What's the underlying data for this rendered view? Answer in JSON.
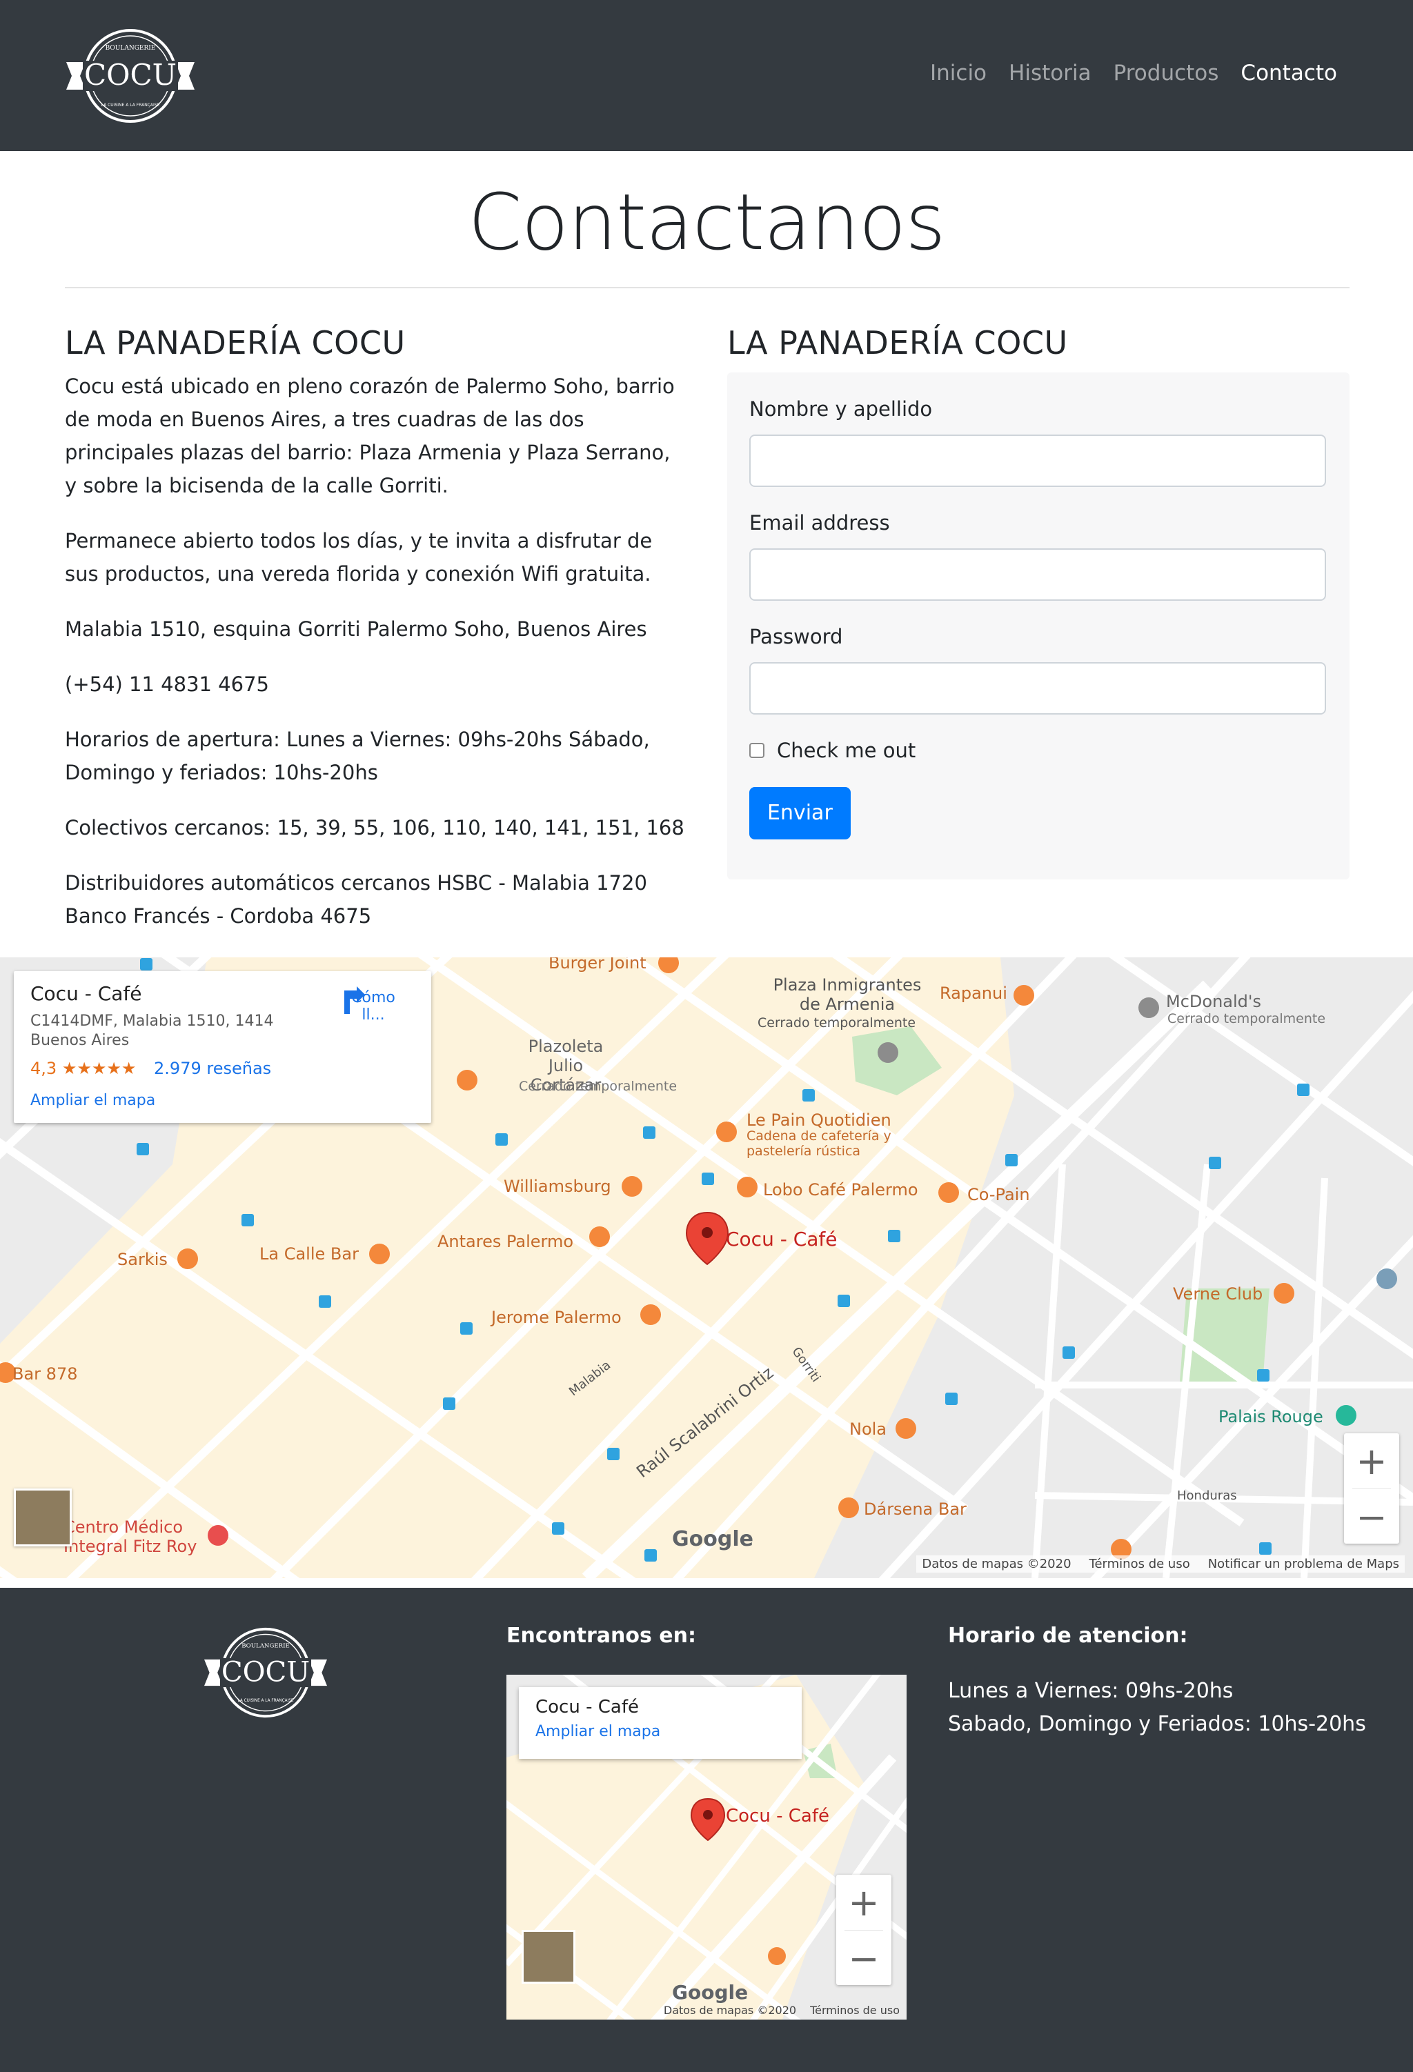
{
  "navbar": {
    "logo": {
      "text": "COCU",
      "arc_text": "BOULANGERIE",
      "tagline": "LA CUISINE A LA FRANÇAISE"
    },
    "links": [
      {
        "label": "Inicio",
        "active": false
      },
      {
        "label": "Historia",
        "active": false
      },
      {
        "label": "Productos",
        "active": false
      },
      {
        "label": "Contacto",
        "active": true
      }
    ]
  },
  "header": {
    "title": "Contactanos"
  },
  "info": {
    "title": "LA PANADERÍA COCU",
    "paragraphs": [
      "Cocu está ubicado en pleno corazón de Palermo Soho, barrio de moda en Buenos Aires, a tres cuadras de las dos principales plazas del barrio: Plaza Armenia y Plaza Serrano, y sobre la bicisenda de la calle Gorriti.",
      "Permanece abierto todos los días, y te invita a disfrutar de sus productos, una vereda florida y conexión Wifi gratuita.",
      "Malabia 1510, esquina Gorriti Palermo Soho, Buenos Aires",
      "(+54) 11 4831 4675",
      "Horarios de apertura: Lunes a Viernes: 09hs-20hs Sábado, Domingo y feriados: 10hs-20hs",
      "Colectivos cercanos: 15, 39, 55, 106, 110, 140, 141, 151, 168",
      "Distribuidores automáticos cercanos HSBC - Malabia 1720 Banco Francés - Cordoba 4675"
    ]
  },
  "form": {
    "title": "LA PANADERÍA COCU",
    "fields": [
      {
        "label": "Nombre y apellido",
        "value": ""
      },
      {
        "label": "Email address",
        "value": ""
      },
      {
        "label": "Password",
        "value": ""
      }
    ],
    "checkbox_label": "Check me out",
    "submit_label": "Enviar",
    "accent_color": "#007bff"
  },
  "map": {
    "card": {
      "title": "Cocu - Café",
      "address": "C1414DMF, Malabia 1510, 1414 Buenos Aires",
      "rating": "4,3",
      "stars": "★★★★★",
      "reviews": "2.979 reseñas",
      "directions": "Cómo ll...",
      "enlarge": "Ampliar el mapa"
    },
    "pin_label": "Cocu - Café",
    "places": [
      "Burger Joint",
      "Plaza Inmigrantes de Armenia",
      "Cerrado temporalmente",
      "Rapanui",
      "McDonald's",
      "Cerrado temporalmente",
      "Plazoleta Julio Cortázar",
      "Cerrado temporalmente",
      "Le Pain Quotidien",
      "Cadena de cafetería y pastelería rústica",
      "Williamsburg",
      "Lobo Café Palermo",
      "Co-Pain",
      "Sarkis",
      "La Calle Bar",
      "Antares Palermo",
      "Jerome Palermo",
      "Verne Club",
      "Palais Rouge",
      "Bar 878",
      "Nola",
      "Dársena Bar",
      "Centro Médico Integral Fitz Roy",
      "Raúl Scalabrini Ortiz",
      "Honduras",
      "Gorriti",
      "Malabia"
    ],
    "attribution": [
      "Datos de mapas ©2020",
      "Términos de uso",
      "Notificar un problema de Maps"
    ],
    "google": "Google",
    "zoom_in": "+",
    "zoom_out": "−"
  },
  "footer": {
    "find_us": "Encontranos en:",
    "hours_title": "Horario de atencion:",
    "hours": [
      "Lunes a Viernes: 09hs-20hs",
      "Sabado, Domingo y Feriados: 10hs-20hs"
    ],
    "mini_map": {
      "title": "Cocu - Café",
      "enlarge": "Ampliar el mapa",
      "pin_label": "Cocu - Café",
      "attribution": [
        "Datos de mapas ©2020",
        "Términos de uso"
      ],
      "google": "Google"
    }
  },
  "colors": {
    "navbar_bg": "#343a40",
    "footer_bg": "#343a40",
    "map_pin": "#ea4335",
    "link_blue": "#1a73e8"
  }
}
